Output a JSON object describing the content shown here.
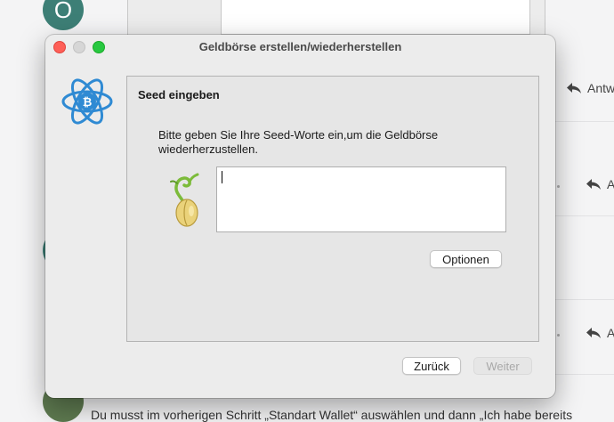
{
  "background": {
    "avatar_letter": "O",
    "reply_label_1": "Antwo",
    "reply_label_2": "A",
    "reply_label_3": "A",
    "post_text": "Du musst im vorherigen Schritt „Standart Wallet“ auswählen und dann „Ich habe bereits"
  },
  "dialog": {
    "title": "Geldbörse erstellen/wiederherstellen",
    "logo_icon": "electrum-bitcoin-logo-icon",
    "panel_title": "Seed eingeben",
    "instruction": "Bitte geben Sie Ihre Seed-Worte ein,um die Geldbörse wiederherzustellen.",
    "seed_icon": "seedling-icon",
    "seed_value": "",
    "options_label": "Optionen",
    "back_label": "Zurück",
    "next_label": "Weiter"
  },
  "colors": {
    "logo_blue": "#2f8ad3",
    "close": "#fe5f57",
    "zoom": "#28c840",
    "avatar": "#3d7f76"
  }
}
